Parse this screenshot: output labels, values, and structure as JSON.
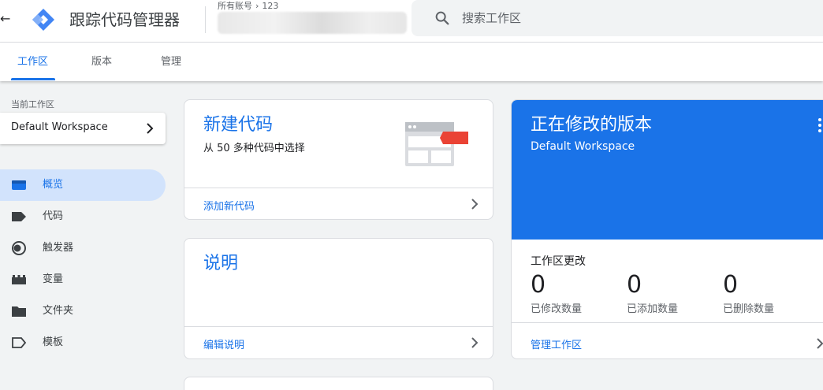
{
  "header": {
    "app_title": "跟踪代码管理器",
    "breadcrumb_root": "所有账号",
    "breadcrumb_account": "123",
    "search_placeholder": "搜索工作区"
  },
  "tabs": [
    {
      "label": "工作区",
      "active": true
    },
    {
      "label": "版本",
      "active": false
    },
    {
      "label": "管理",
      "active": false
    }
  ],
  "sidebar": {
    "current_workspace_label": "当前工作区",
    "workspace_name": "Default Workspace",
    "items": [
      {
        "label": "概览",
        "icon": "overview-icon",
        "active": true
      },
      {
        "label": "代码",
        "icon": "tag-icon",
        "active": false
      },
      {
        "label": "触发器",
        "icon": "trigger-icon",
        "active": false
      },
      {
        "label": "变量",
        "icon": "variable-icon",
        "active": false
      },
      {
        "label": "文件夹",
        "icon": "folder-icon",
        "active": false
      },
      {
        "label": "模板",
        "icon": "template-icon",
        "active": false
      }
    ]
  },
  "new_tag_card": {
    "title": "新建代码",
    "subtitle": "从 50 多种代码中选择",
    "link": "添加新代码"
  },
  "description_card": {
    "title": "说明",
    "link": "编辑说明"
  },
  "version_card": {
    "title": "正在修改的版本",
    "workspace": "Default Workspace",
    "changes_label": "工作区更改",
    "stats": [
      {
        "value": "0",
        "label": "已修改数量"
      },
      {
        "value": "0",
        "label": "已添加数量"
      },
      {
        "value": "0",
        "label": "已删除数量"
      }
    ],
    "link": "管理工作区"
  },
  "colors": {
    "accent": "#1a73e8",
    "active_nav_bg": "#d2e3fc",
    "page_bg": "#f1f3f4"
  }
}
